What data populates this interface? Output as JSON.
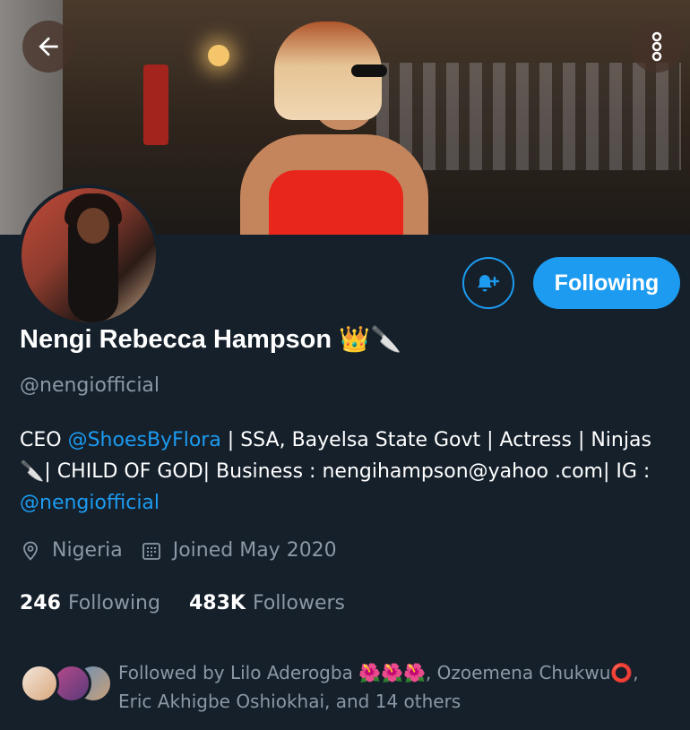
{
  "header": {
    "back_icon": "arrow-left-icon",
    "more_icon": "more-vertical-icon"
  },
  "profile": {
    "name": "Nengi Rebecca Hampson",
    "name_emojis": "👑🔪",
    "handle": "@nengiofficial",
    "bio": {
      "part1": "CEO ",
      "mention1": "@ShoesByFlora",
      "part2": " | SSA, Bayelsa State Govt | Actress | Ninjas🔪| CHILD OF GOD| Business : nengihampson@yahoo .com| IG : ",
      "mention2": "@nengiofficial"
    },
    "location": "Nigeria",
    "joined": "Joined May 2020",
    "following_count": "246",
    "following_label": "Following",
    "followers_count": "483K",
    "followers_label": "Followers",
    "followed_by": "Followed by Lilo Aderogba 🌺🌺🌺, Ozoemena Chukwu⭕, Eric Akhigbe Oshiokhai, and 14 others"
  },
  "actions": {
    "notify_icon": "bell-plus-icon",
    "following_button": "Following"
  },
  "colors": {
    "background": "#15202b",
    "accent": "#1d9bf0",
    "secondary_text": "#8b98a5"
  }
}
